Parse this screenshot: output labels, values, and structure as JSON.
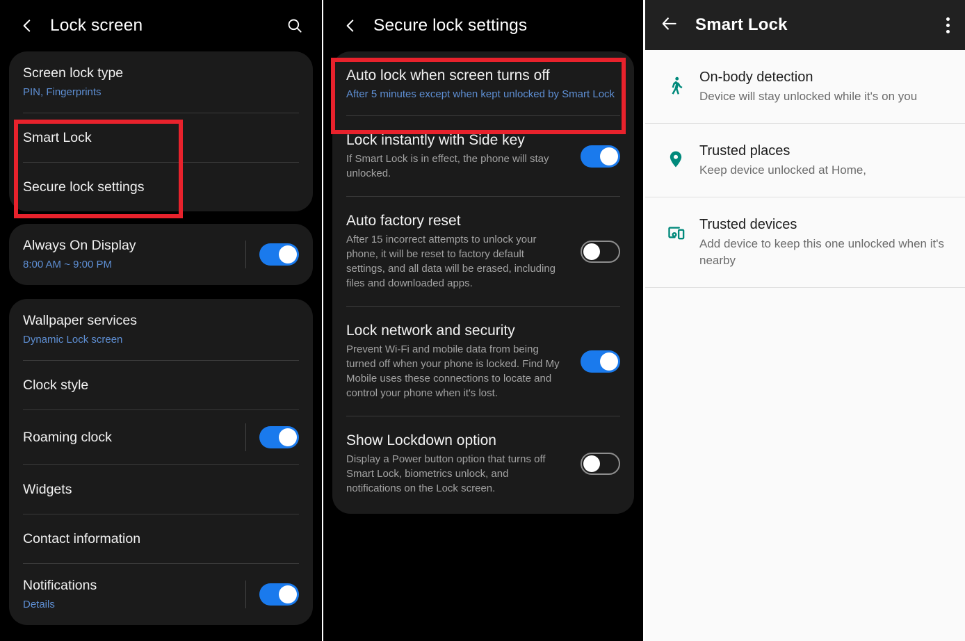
{
  "panel1": {
    "header": {
      "title": "Lock screen",
      "back_icon": "chevron-left-icon",
      "search_icon": "search-icon"
    },
    "card1": [
      {
        "title": "Screen lock type",
        "subtitle": "PIN, Fingerprints",
        "subtitle_style": "link"
      },
      {
        "title": "Smart Lock",
        "subtitle": "",
        "subtitle_style": "none"
      },
      {
        "title": "Secure lock settings",
        "subtitle": "",
        "subtitle_style": "none"
      }
    ],
    "card2": [
      {
        "title": "Always On Display",
        "subtitle": "8:00 AM ~ 9:00 PM",
        "subtitle_style": "link",
        "toggle": "on"
      }
    ],
    "card3": [
      {
        "title": "Wallpaper services",
        "subtitle": "Dynamic Lock screen",
        "subtitle_style": "link",
        "toggle": "none"
      },
      {
        "title": "Clock style",
        "subtitle": "",
        "subtitle_style": "none",
        "toggle": "none"
      },
      {
        "title": "Roaming clock",
        "subtitle": "",
        "subtitle_style": "none",
        "toggle": "on"
      },
      {
        "title": "Widgets",
        "subtitle": "",
        "subtitle_style": "none",
        "toggle": "none"
      },
      {
        "title": "Contact information",
        "subtitle": "",
        "subtitle_style": "none",
        "toggle": "none"
      },
      {
        "title": "Notifications",
        "subtitle": "Details",
        "subtitle_style": "link",
        "toggle": "on"
      }
    ],
    "highlight_color": "#e8222c"
  },
  "panel2": {
    "header": {
      "title": "Secure lock settings",
      "back_icon": "chevron-left-icon"
    },
    "rows": [
      {
        "title": "Auto lock when screen turns off",
        "subtitle": "After 5 minutes except when kept unlocked by Smart Lock",
        "subtitle_style": "link",
        "toggle": "none",
        "highlighted": "true"
      },
      {
        "title": "Lock instantly with Side key",
        "subtitle": "If Smart Lock is in effect, the phone will stay unlocked.",
        "subtitle_style": "grey",
        "toggle": "on"
      },
      {
        "title": "Auto factory reset",
        "subtitle": "After 15 incorrect attempts to unlock your phone, it will be reset to factory default settings, and all data will be erased, including files and downloaded apps.",
        "subtitle_style": "grey",
        "toggle": "off"
      },
      {
        "title": "Lock network and security",
        "subtitle": "Prevent Wi-Fi and mobile data from being turned off when your phone is locked. Find My Mobile uses these connections to locate and control your phone when it's lost.",
        "subtitle_style": "grey",
        "toggle": "on"
      },
      {
        "title": "Show Lockdown option",
        "subtitle": "Display a Power button option that turns off Smart Lock, biometrics unlock, and notifications on the Lock screen.",
        "subtitle_style": "grey",
        "toggle": "off"
      }
    ]
  },
  "panel3": {
    "header": {
      "title": "Smart Lock",
      "back_icon": "arrow-left-icon",
      "overflow_icon": "more-vertical-icon"
    },
    "accent_color": "#00897b",
    "rows": [
      {
        "icon": "walking-person-icon",
        "title": "On-body detection",
        "subtitle": "Device will stay unlocked while it's on you"
      },
      {
        "icon": "location-pin-icon",
        "title": "Trusted places",
        "subtitle": "Keep device unlocked at Home,"
      },
      {
        "icon": "devices-icon",
        "title": "Trusted devices",
        "subtitle": "Add device to keep this one unlocked when it's nearby"
      }
    ]
  }
}
